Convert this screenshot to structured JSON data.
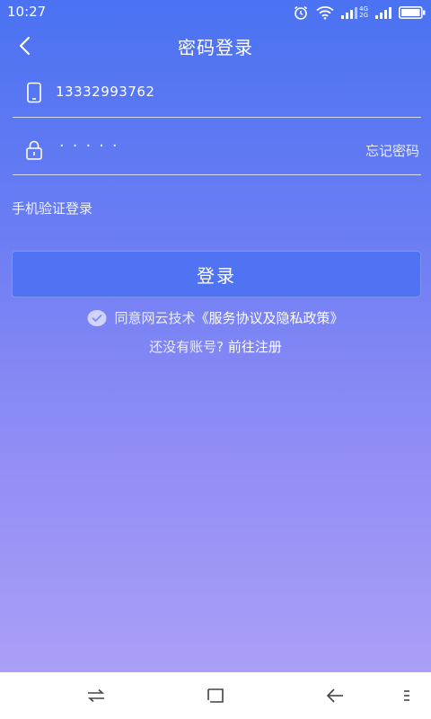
{
  "status_bar": {
    "time": "10:27",
    "network_types": [
      "4G",
      "2G"
    ],
    "icons": [
      "alarm-icon",
      "wifi-icon",
      "signal-icon",
      "signal-icon",
      "battery-icon"
    ]
  },
  "header": {
    "title": "密码登录",
    "back_icon": "chevron-left-icon"
  },
  "form": {
    "phone": {
      "value": "13332993762",
      "icon": "phone-icon"
    },
    "password": {
      "masked_value": "·····",
      "icon": "lock-icon",
      "forgot_label": "忘记密码"
    },
    "sms_login_label": "手机验证登录",
    "login_button_label": "登录",
    "agreement": {
      "text": "同意网云技术",
      "link": "《服务协议及隐私政策》",
      "checked": true
    },
    "register": {
      "question": "还没有账号?",
      "link": "前往注册"
    }
  },
  "nav_bar": {
    "icons": [
      "switch-apps-icon",
      "home-square-icon",
      "back-arrow-icon",
      "menu-icon"
    ]
  },
  "colors": {
    "gradient_top": "#4a72f2",
    "gradient_bottom": "#aa9ff7",
    "button": "#4f73f3"
  }
}
